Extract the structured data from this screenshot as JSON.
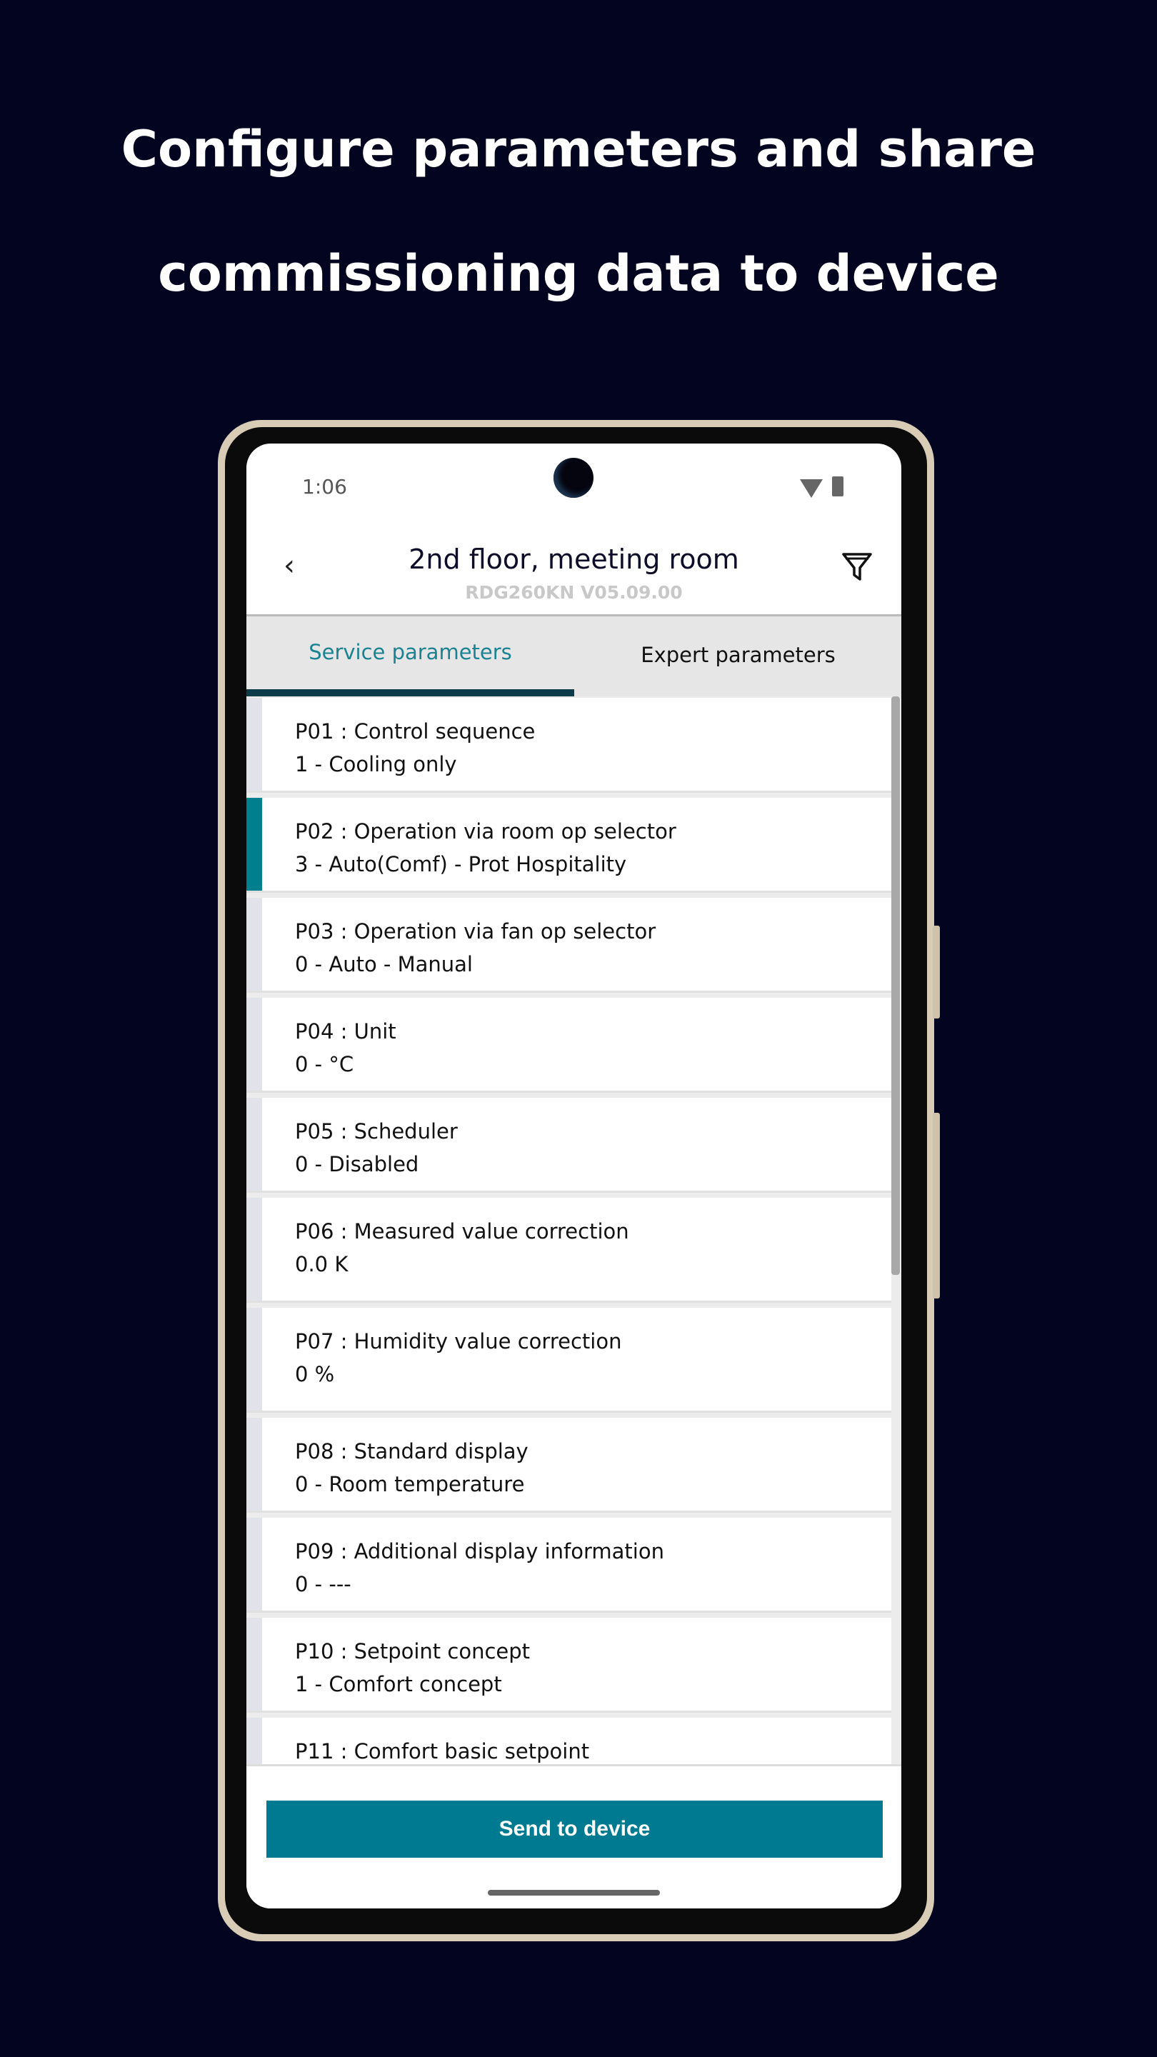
{
  "headline": {
    "line1": "Configure parameters and share",
    "line2": "commissioning data to device"
  },
  "status_bar": {
    "time": "1:06",
    "icons": [
      "wifi-icon",
      "battery-icon"
    ]
  },
  "header": {
    "title": "2nd floor, meeting room",
    "subtitle": "RDG260KN  V05.09.00",
    "back_icon": "chevron-left-icon",
    "filter_icon": "filter-icon"
  },
  "tabs": [
    {
      "label": "Service parameters",
      "active": true
    },
    {
      "label": "Expert parameters",
      "active": false
    }
  ],
  "colors": {
    "accent": "#007a90",
    "background": "#03041f",
    "tab_active_text": "#1a8291"
  },
  "parameters": [
    {
      "name": "P01 : Control sequence",
      "value": "1 - Cooling only"
    },
    {
      "name": "P02 : Operation via room op selector",
      "value": "3 - Auto(Comf) - Prot Hospitality",
      "selected": true
    },
    {
      "name": "P03 : Operation via fan op selector",
      "value": "0 - Auto - Manual"
    },
    {
      "name": "P04 : Unit",
      "value": "0 - °C"
    },
    {
      "name": "P05 : Scheduler",
      "value": "0 - Disabled"
    },
    {
      "name": "P06 : Measured value correction",
      "value": "0.0 K"
    },
    {
      "name": "P07 : Humidity value correction",
      "value": "0 %"
    },
    {
      "name": "P08 : Standard display",
      "value": "0 - Room temperature"
    },
    {
      "name": "P09 : Additional display information",
      "value": "0 - ---"
    },
    {
      "name": "P10 : Setpoint concept",
      "value": "1 - Comfort concept"
    },
    {
      "name": "P11 : Comfort basic setpoint",
      "value": ""
    }
  ],
  "footer": {
    "send_label": "Send to device"
  }
}
